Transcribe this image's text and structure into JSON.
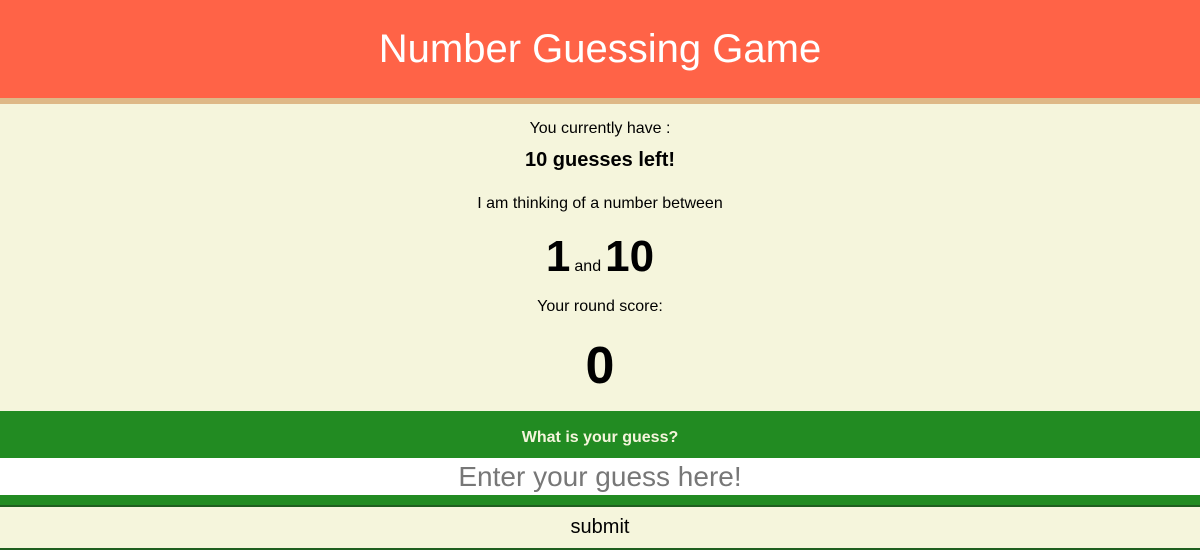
{
  "header": {
    "title": "Number Guessing Game"
  },
  "status": {
    "intro": "You currently have :",
    "guesses_left": "10 guesses left!",
    "range_intro": "I am thinking of a number between",
    "range_min": "1",
    "range_and": "and",
    "range_max": "10",
    "score_label": "Your round score:",
    "score_value": "0"
  },
  "guess_form": {
    "label": "What is your guess?",
    "placeholder": "Enter your guess here!",
    "value": "",
    "submit_label": "submit"
  },
  "colors": {
    "header_bg": "#ff6347",
    "header_border": "#deb887",
    "page_bg": "#f5f5dc",
    "guess_bar_bg": "#228b22"
  }
}
